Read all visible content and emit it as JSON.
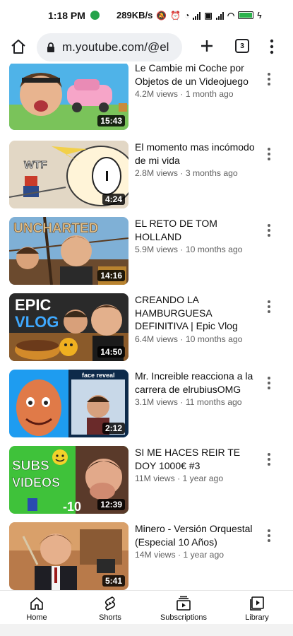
{
  "status_bar": {
    "time": "1:18 PM",
    "speed": "289KB/s",
    "battery_label": "battery-icon"
  },
  "browser": {
    "url": "m.youtube.com/@el",
    "tabs_count": "3"
  },
  "videos": [
    {
      "title": "Le Cambie mi Coche por Objetos de un Videojuego",
      "views": "4.2M views",
      "age": "1 month ago",
      "duration": "15:43"
    },
    {
      "title": "El momento mas incómodo de mi vida",
      "views": "2.8M views",
      "age": "3 months ago",
      "duration": "4:24"
    },
    {
      "title": "EL RETO DE TOM HOLLAND",
      "views": "5.9M views",
      "age": "10 months ago",
      "duration": "14:16"
    },
    {
      "title": "CREANDO LA HAMBURGUESA DEFINITIVA | Epic Vlog",
      "views": "6.4M views",
      "age": "10 months ago",
      "duration": "14:50"
    },
    {
      "title": "Mr. Increible reacciona a la carrera de elrubiusOMG",
      "views": "3.1M views",
      "age": "11 months ago",
      "duration": "2:12"
    },
    {
      "title": "SI ME HACES REIR TE DOY 1000€ #3",
      "views": "11M views",
      "age": "1 year ago",
      "duration": "12:39"
    },
    {
      "title": "Minero - Versión Orquestal (Especial 10 Años)",
      "views": "14M views",
      "age": "1 year ago",
      "duration": "5:41"
    }
  ],
  "thumb_text": {
    "wtf": "WTF",
    "uncharted": "UNCHARTED",
    "epic": "EPIC",
    "vlog": "VLOG",
    "face_reveal": "face reveal",
    "subs": "SUBS",
    "videos": "VIDEOS",
    "minus10": "-10"
  },
  "separator": "·",
  "nav": {
    "home": "Home",
    "shorts": "Shorts",
    "subscriptions": "Subscriptions",
    "library": "Library"
  }
}
